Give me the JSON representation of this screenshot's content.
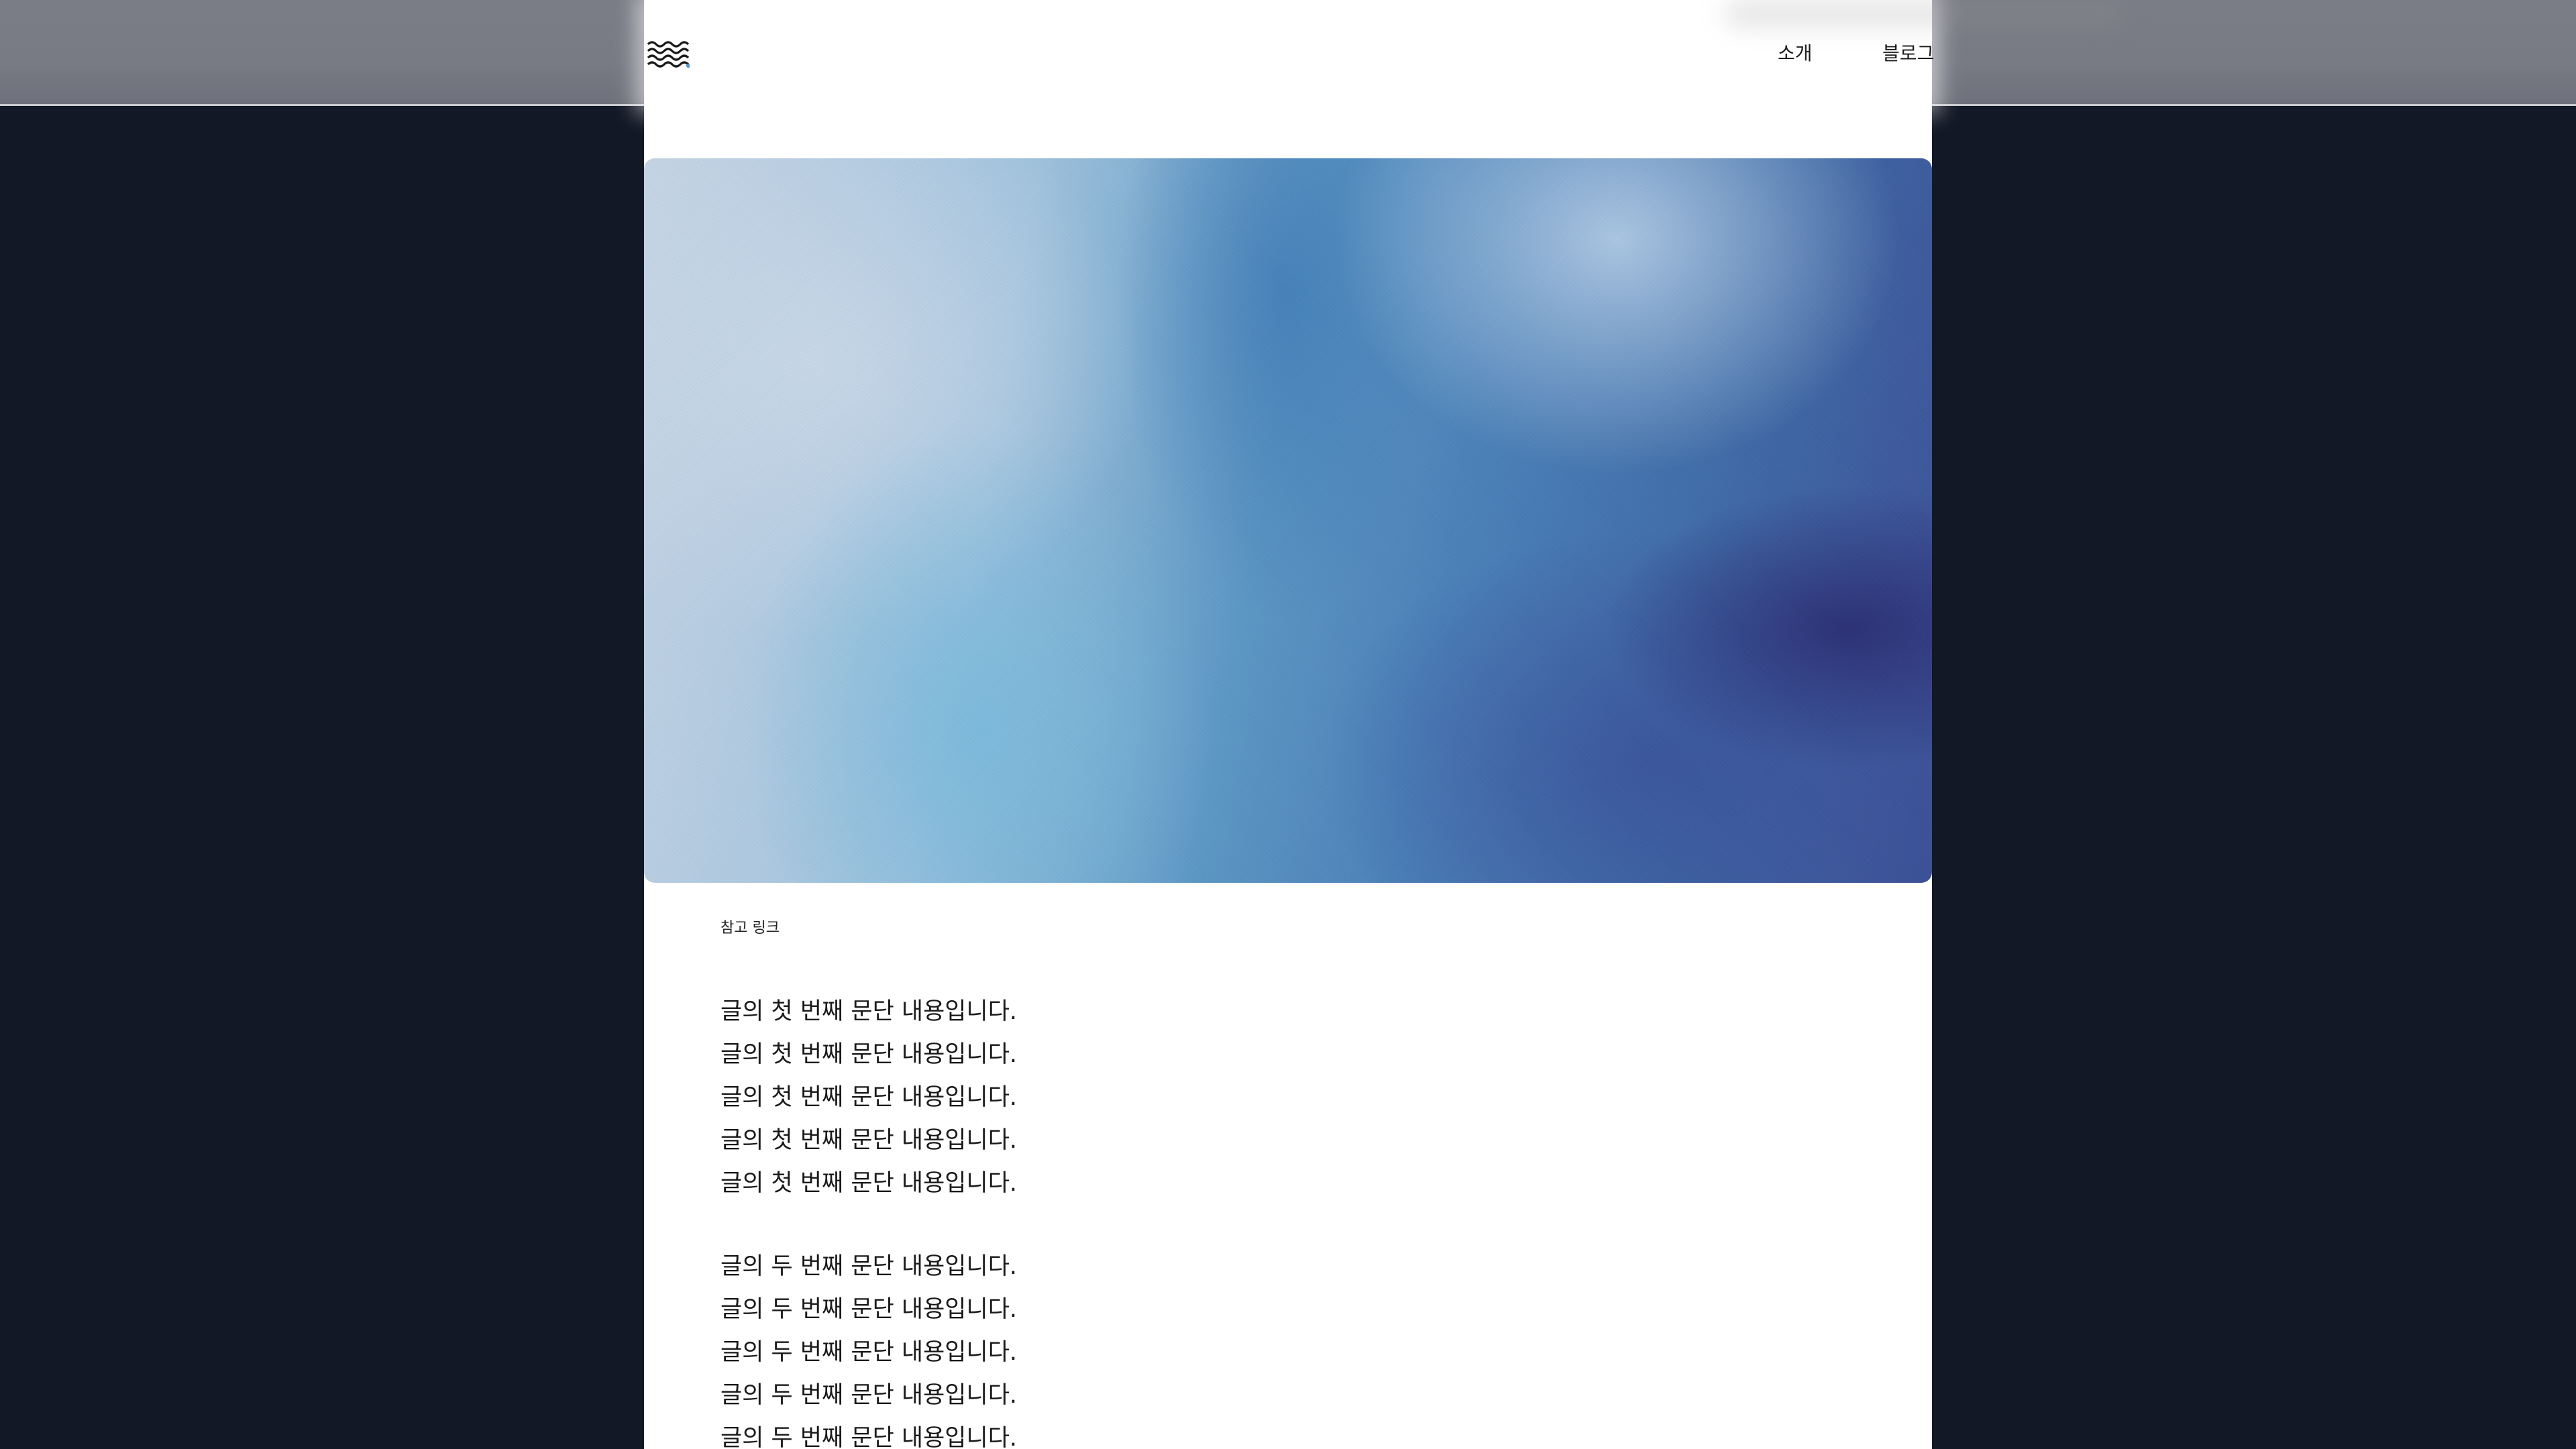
{
  "header": {
    "nav": {
      "about": "소개",
      "blog": "블로그"
    }
  },
  "main": {
    "hero": {
      "description_colors": [
        "#c4d3e4",
        "#9ec1dc",
        "#5a96c4",
        "#3e6aa6",
        "#3b4f96"
      ]
    },
    "reference_link": "참고 링크",
    "paragraphs": [
      {
        "lines": [
          "글의 첫 번째 문단 내용입니다.",
          "글의 첫 번째 문단 내용입니다.",
          "글의 첫 번째 문단 내용입니다.",
          "글의 첫 번째 문단 내용입니다.",
          "글의 첫 번째 문단 내용입니다."
        ]
      },
      {
        "lines": [
          "글의 두 번째 문단 내용입니다.",
          "글의 두 번째 문단 내용입니다.",
          "글의 두 번째 문단 내용입니다.",
          "글의 두 번째 문단 내용입니다.",
          "글의 두 번째 문단 내용입니다."
        ]
      }
    ]
  },
  "colors": {
    "background": "#121826",
    "header_side": "#7a7c86",
    "content": "#ffffff",
    "text": "#1a1a1a"
  },
  "icons": {
    "logo": "waves-logo-icon"
  }
}
